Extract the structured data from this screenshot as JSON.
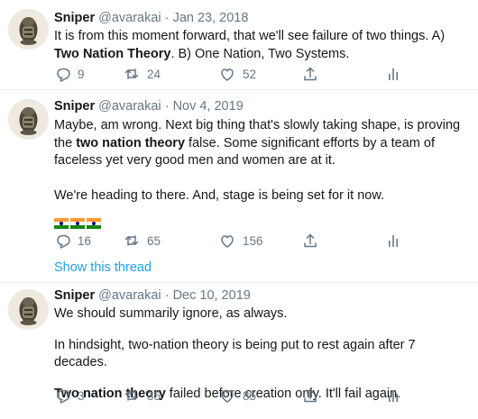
{
  "tweets": [
    {
      "name": "Sniper",
      "handle": "@avarakai",
      "separator": "·",
      "date": "Jan 23, 2018",
      "text_a": "It is from this moment forward, that we'll see failure of two things. A) ",
      "text_b": "Two Nation Theory",
      "text_c": ". B) One Nation, Two Systems.",
      "replies": "9",
      "retweets": "24",
      "likes": "52"
    },
    {
      "name": "Sniper",
      "handle": "@avarakai",
      "separator": "·",
      "date": "Nov 4, 2019",
      "p1_a": "Maybe, am wrong. Next big thing that's slowly taking shape, is proving the ",
      "p1_b": "two nation theory",
      "p1_c": " false. Some significant efforts by a team of faceless yet very good men and women are at it.",
      "p2": "We're heading to there. And, stage is being set for it now.",
      "replies": "16",
      "retweets": "65",
      "likes": "156",
      "show_thread": "Show this thread"
    },
    {
      "name": "Sniper",
      "handle": "@avarakai",
      "separator": "·",
      "date": "Dec 10, 2019",
      "p1": "We should summarily ignore, as always.",
      "p2": "In hindsight, two-nation theory is being put to rest again after 7 decades.",
      "p3_a": "Two nation theory",
      "p3_b": " failed before creation only. It'll fail again.",
      "replies": "3",
      "retweets": "35",
      "likes": "85"
    }
  ],
  "icons": {
    "reply": "reply-icon",
    "retweet": "retweet-icon",
    "like": "heart-icon",
    "share": "share-icon",
    "analytics": "analytics-icon",
    "flag": "india-flag-icon"
  },
  "colors": {
    "link": "#1da1f2",
    "muted": "#657786",
    "saffron": "#ff9933",
    "green": "#138808"
  }
}
